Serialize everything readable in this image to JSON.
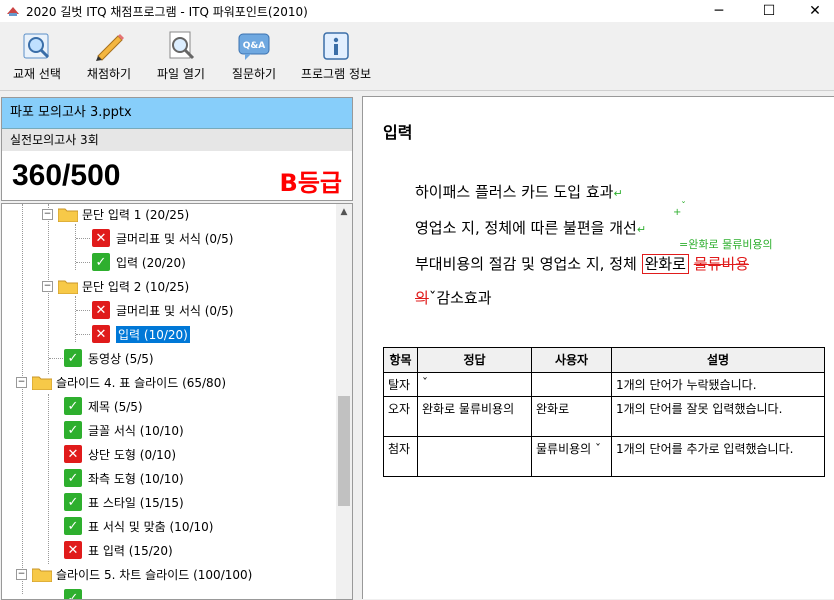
{
  "window": {
    "title": "2020 길벗 ITQ 채점프로그램 - ITQ 파워포인트(2010)",
    "minimize": "─",
    "maximize": "☐",
    "close": "✕"
  },
  "toolbar": {
    "buttons": [
      {
        "label": "교재 선택",
        "icon": "book-search-icon"
      },
      {
        "label": "채점하기",
        "icon": "pencil-icon"
      },
      {
        "label": "파일 열기",
        "icon": "file-magnifier-icon"
      },
      {
        "label": "질문하기",
        "icon": "qa-bubble-icon"
      },
      {
        "label": "프로그램 정보",
        "icon": "info-icon"
      }
    ]
  },
  "summary": {
    "file": "파포 모의고사 3.pptx",
    "exam": "실전모의고사 3회",
    "score": "360/500",
    "grade": "B등급",
    "grade_color": "#ff0000"
  },
  "tree": {
    "items": [
      {
        "label": "문단 입력 1 (20/25)",
        "type": "folder",
        "expanded": true
      },
      {
        "label": "글머리표 및 서식 (0/5)",
        "status": "fail"
      },
      {
        "label": "입력 (20/20)",
        "status": "pass"
      },
      {
        "label": "문단 입력 2 (10/25)",
        "type": "folder",
        "expanded": true
      },
      {
        "label": "글머리표 및 서식 (0/5)",
        "status": "fail"
      },
      {
        "label": "입력 (10/20)",
        "status": "fail",
        "selected": true
      },
      {
        "label": "동영상 (5/5)",
        "status": "pass"
      },
      {
        "label": "슬라이드 4. 표 슬라이드 (65/80)",
        "type": "folder",
        "expanded": true
      },
      {
        "label": "제목 (5/5)",
        "status": "pass"
      },
      {
        "label": "글꼴 서식 (10/10)",
        "status": "pass"
      },
      {
        "label": "상단 도형 (0/10)",
        "status": "fail"
      },
      {
        "label": "좌측 도형 (10/10)",
        "status": "pass"
      },
      {
        "label": "표 스타일 (15/15)",
        "status": "pass"
      },
      {
        "label": "표 서식 및 맞춤 (10/10)",
        "status": "pass"
      },
      {
        "label": "표 입력 (15/20)",
        "status": "fail"
      },
      {
        "label": "슬라이드 5. 차트 슬라이드 (100/100)",
        "type": "folder",
        "expanded": true
      }
    ]
  },
  "detail": {
    "heading": "입력",
    "lines": {
      "l1": "하이패스 플러스 카드 도입 효과",
      "l2": "영업소 지, 정체에 따른 불편을 개선",
      "l3_a": "부대비용의 절감 및 영업소 지, 정체 ",
      "l3_box": "완화로",
      "l3_strike": "물류비용",
      "l4_strike": "의",
      "l4_rest": "감소효과",
      "para_mark": "↵",
      "caret": "ˇ",
      "plus": "+"
    },
    "annotation": "=완화로 물류비용의",
    "table": {
      "headers": [
        "항목",
        "정답",
        "사용자",
        "설명"
      ],
      "rows": [
        {
          "item": "탈자",
          "answer": "ˇ",
          "user": "",
          "desc": "1개의 단어가 누락됐습니다."
        },
        {
          "item": "오자",
          "answer": "완화로 물류비용의",
          "user": "완화로",
          "desc": "1개의 단어를 잘못 입력했습니다."
        },
        {
          "item": "첨자",
          "answer": "",
          "user": "물류비용의 ˇ",
          "desc": "1개의 단어를 추가로 입력했습니다."
        }
      ]
    }
  }
}
